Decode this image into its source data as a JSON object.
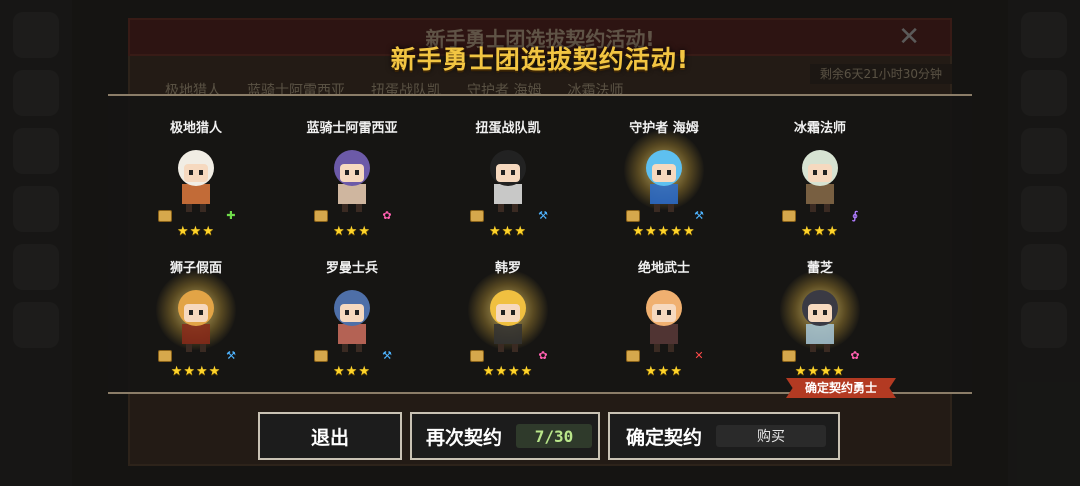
{
  "background": {
    "title": "新手勇士团选拔契约活动!",
    "tabs": [
      "极地猎人",
      "蓝骑士阿雷西亚",
      "扭蛋战队凯",
      "守护者 海姆",
      "冰霜法师"
    ],
    "timer": "剩余6天21小时30分钟"
  },
  "title": "新手勇士团选拔契约活动!",
  "heroes": [
    {
      "name": "极地猎人",
      "stars": "★★★",
      "element": "green-cross",
      "glow": false
    },
    {
      "name": "蓝骑士阿雷西亚",
      "stars": "★★★",
      "element": "pink-gear",
      "glow": false
    },
    {
      "name": "扭蛋战队凯",
      "stars": "★★★",
      "element": "blue-hammer",
      "glow": false
    },
    {
      "name": "守护者 海姆",
      "stars": "★★★★★",
      "element": "blue-hammer",
      "glow": true
    },
    {
      "name": "冰霜法师",
      "stars": "★★★",
      "element": "purple-staff",
      "glow": false
    },
    {
      "name": "狮子假面",
      "stars": "★★★★",
      "element": "blue-hammer",
      "glow": true
    },
    {
      "name": "罗曼士兵",
      "stars": "★★★",
      "element": "blue-hammer",
      "glow": false
    },
    {
      "name": "韩罗",
      "stars": "★★★★",
      "element": "pink-gear",
      "glow": true
    },
    {
      "name": "绝地武士",
      "stars": "★★★",
      "element": "red-swords",
      "glow": false
    },
    {
      "name": "蕾芝",
      "stars": "★★★★",
      "element": "pink-gear",
      "glow": true
    }
  ],
  "ribbon": "确定契约勇士",
  "buttons": {
    "exit": "退出",
    "again": "再次契约",
    "again_count": "7/30",
    "confirm": "确定契约",
    "buy": "购买"
  },
  "colors": {
    "title": "#f2c542",
    "star": "#ffd42a",
    "counter_text": "#b9e68a",
    "ribbon": "#b33a22"
  }
}
